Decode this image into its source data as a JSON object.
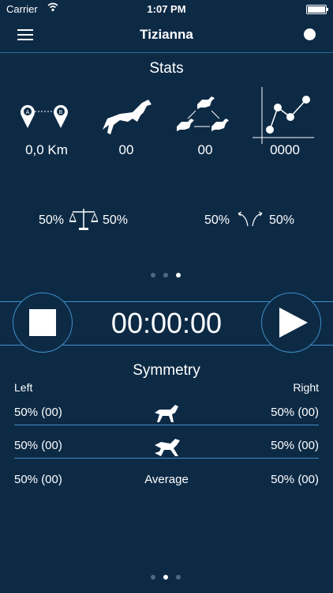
{
  "status": {
    "carrier": "Carrier",
    "time": "1:07 PM"
  },
  "nav": {
    "title": "Tizianna"
  },
  "stats": {
    "title": "Stats",
    "distance": "0,0 Km",
    "jumps": "00",
    "transitions": "00",
    "points": "0000",
    "balance_left": "50%",
    "balance_right": "50%",
    "turn_left": "50%",
    "turn_right": "50%"
  },
  "timer": {
    "value": "00:00:00"
  },
  "symmetry": {
    "title": "Symmetry",
    "left_label": "Left",
    "right_label": "Right",
    "trot_left": "50% (00)",
    "trot_right": "50% (00)",
    "canter_left": "50% (00)",
    "canter_right": "50% (00)",
    "avg_left": "50% (00)",
    "avg_label": "Average",
    "avg_right": "50% (00)"
  },
  "pager_top": {
    "count": 3,
    "active": 2
  },
  "pager_bottom": {
    "count": 3,
    "active": 1
  },
  "colors": {
    "background": "#0d2a45",
    "accent": "#3d8fc6"
  }
}
